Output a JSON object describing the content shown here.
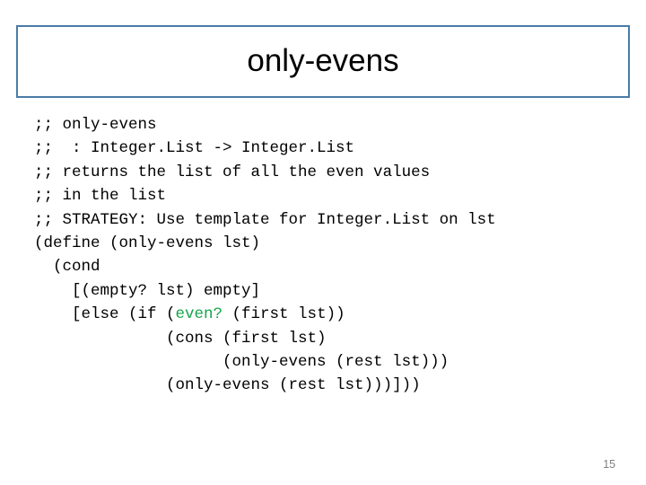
{
  "slide": {
    "title": "only-evens",
    "page_number": "15",
    "accent_color": "#4a7ba7",
    "highlight_color": "#16a34a",
    "code_lines": [
      ";; only-evens",
      ";;  : Integer.List -> Integer.List",
      ";; returns the list of all the even values",
      ";; in the list",
      ";; STRATEGY: Use template for Integer.List on lst",
      "(define (only-evens lst)",
      "  (cond",
      "    [(empty? lst) empty]",
      "    [else (if (even? (first lst))",
      "              (cons (first lst)",
      "                    (only-evens (rest lst)))",
      "              (only-evens (rest lst)))])) "
    ],
    "code_segments": [
      [
        {
          "t": ";; only-evens",
          "h": false
        }
      ],
      [
        {
          "t": ";;  : Integer.List -> Integer.List",
          "h": false
        }
      ],
      [
        {
          "t": ";; returns the list of all the even values",
          "h": false
        }
      ],
      [
        {
          "t": ";; in the list",
          "h": false
        }
      ],
      [
        {
          "t": ";; STRATEGY: Use template for Integer.List on lst",
          "h": false
        }
      ],
      [
        {
          "t": "(define (only-evens lst)",
          "h": false
        }
      ],
      [
        {
          "t": "  (cond",
          "h": false
        }
      ],
      [
        {
          "t": "    [(empty? lst) empty]",
          "h": false
        }
      ],
      [
        {
          "t": "    [else (if (",
          "h": false
        },
        {
          "t": "even?",
          "h": true
        },
        {
          "t": " (first lst))",
          "h": false
        }
      ],
      [
        {
          "t": "              (cons (first lst)",
          "h": false
        }
      ],
      [
        {
          "t": "                    (only-evens (rest lst)))",
          "h": false
        }
      ],
      [
        {
          "t": "              (only-evens (rest lst)))]))",
          "h": false
        }
      ]
    ]
  }
}
